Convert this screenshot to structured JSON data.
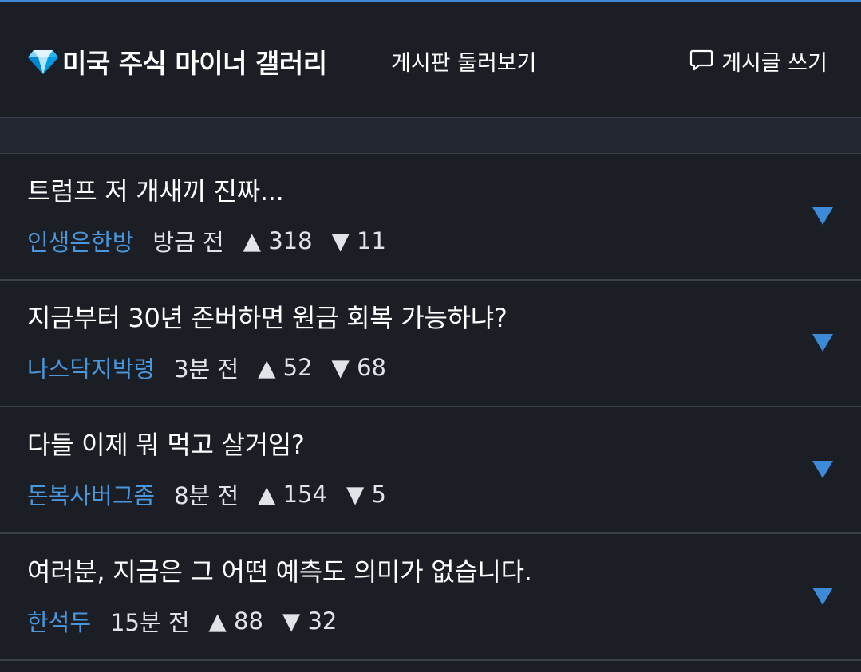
{
  "header": {
    "title": "미국 주식 마이너 갤러리",
    "browse_label": "게시판 둘러보기",
    "write_label": "게시글 쓰기"
  },
  "colors": {
    "accent": "#3d8bd8",
    "author": "#4a97dc",
    "background": "#1b1e25",
    "divider": "#3a3f4a"
  },
  "icons": {
    "title_icon": "gem-icon",
    "write_icon": "comment-icon",
    "expand_icon": "triangle-down-icon"
  },
  "posts": [
    {
      "title": "트럼프 저 개새끼 진짜...",
      "author": "인생은한방",
      "time": "방금 전",
      "up": "▲ 318",
      "down": "▼ 11"
    },
    {
      "title": "지금부터 30년 존버하면 원금 회복 가능하냐?",
      "author": "나스닥지박령",
      "time": "3분 전",
      "up": "▲ 52",
      "down": "▼ 68"
    },
    {
      "title": "다들 이제 뭐 먹고 살거임?",
      "author": "돈복사버그좀",
      "time": "8분 전",
      "up": "▲ 154",
      "down": "▼ 5"
    },
    {
      "title": "여러분, 지금은 그 어떤 예측도 의미가 없습니다.",
      "author": "한석두",
      "time": "15분 전",
      "up": "▲ 88",
      "down": "▼ 32"
    }
  ]
}
